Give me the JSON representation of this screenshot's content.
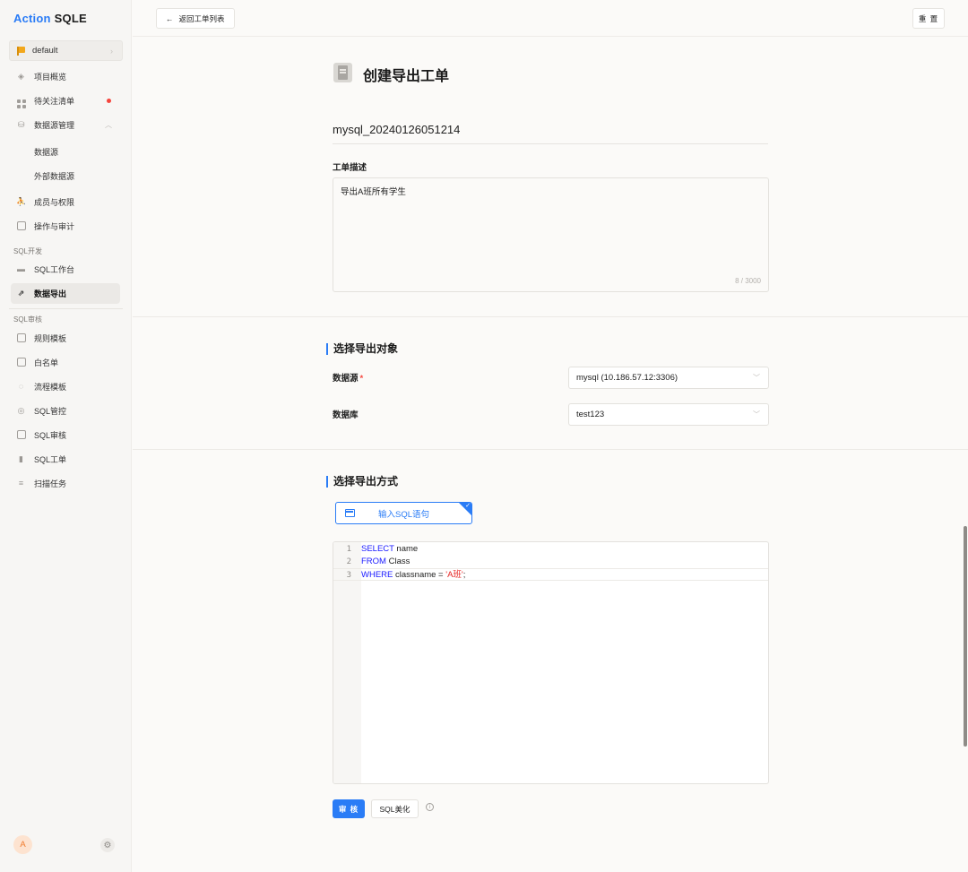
{
  "brand": {
    "part1": "Action",
    "part2": "SQLE"
  },
  "project": {
    "name": "default",
    "flag_color": "#f2a71b"
  },
  "sidebar": {
    "items": [
      {
        "label": "项目概览",
        "icon": "cube-icon"
      },
      {
        "label": "待关注清单",
        "icon": "dashboard-icon",
        "badge": "dot"
      },
      {
        "label": "数据源管理",
        "icon": "database-icon",
        "expanded": true
      },
      {
        "label": "数据源"
      },
      {
        "label": "外部数据源"
      },
      {
        "label": "成员与权限",
        "icon": "members-icon"
      },
      {
        "label": "操作与审计",
        "icon": "audit-log-icon"
      }
    ],
    "section_dev": "SQL开发",
    "dev_items": [
      {
        "label": "SQL工作台",
        "icon": "monitor-icon"
      },
      {
        "label": "数据导出",
        "icon": "export-icon",
        "active": true
      }
    ],
    "section_audit": "SQL审核",
    "audit_items": [
      {
        "label": "规则模板",
        "icon": "rule-template-icon"
      },
      {
        "label": "白名单",
        "icon": "whitelist-icon"
      },
      {
        "label": "流程模板",
        "icon": "workflow-icon"
      },
      {
        "label": "SQL管控",
        "icon": "fingerprint-icon"
      },
      {
        "label": "SQL审核",
        "icon": "sql-audit-icon"
      },
      {
        "label": "SQL工单",
        "icon": "clipboard-icon"
      },
      {
        "label": "扫描任务",
        "icon": "list-icon"
      }
    ],
    "user_avatar": "A"
  },
  "topbar": {
    "back_label": "返回工单列表",
    "reset_label": "重 置"
  },
  "form": {
    "page_title": "创建导出工单",
    "workorder_name": "mysql_20240126051214",
    "desc_label": "工单描述",
    "desc_value": "导出A班所有学生",
    "desc_count": "8 / 3000",
    "section_object": "选择导出对象",
    "datasource_label": "数据源",
    "datasource_value": "mysql (10.186.57.12:3306)",
    "database_label": "数据库",
    "database_value": "test123",
    "section_method": "选择导出方式",
    "method_label": "输入SQL语句",
    "audit_label": "审 核",
    "beautify_label": "SQL美化"
  },
  "sql_editor": {
    "lines": [
      {
        "no": "1",
        "kw": "SELECT",
        "rest": " name"
      },
      {
        "no": "2",
        "kw": "FROM",
        "rest": " Class"
      },
      {
        "no": "3",
        "kw": "WHERE",
        "rest": " classname = ",
        "str": "'A班'",
        "tail": ";"
      }
    ]
  },
  "colors": {
    "accent": "#2a7cf6",
    "required": "#f5453d",
    "keyword": "#1a1aff",
    "string": "#e6211f"
  }
}
